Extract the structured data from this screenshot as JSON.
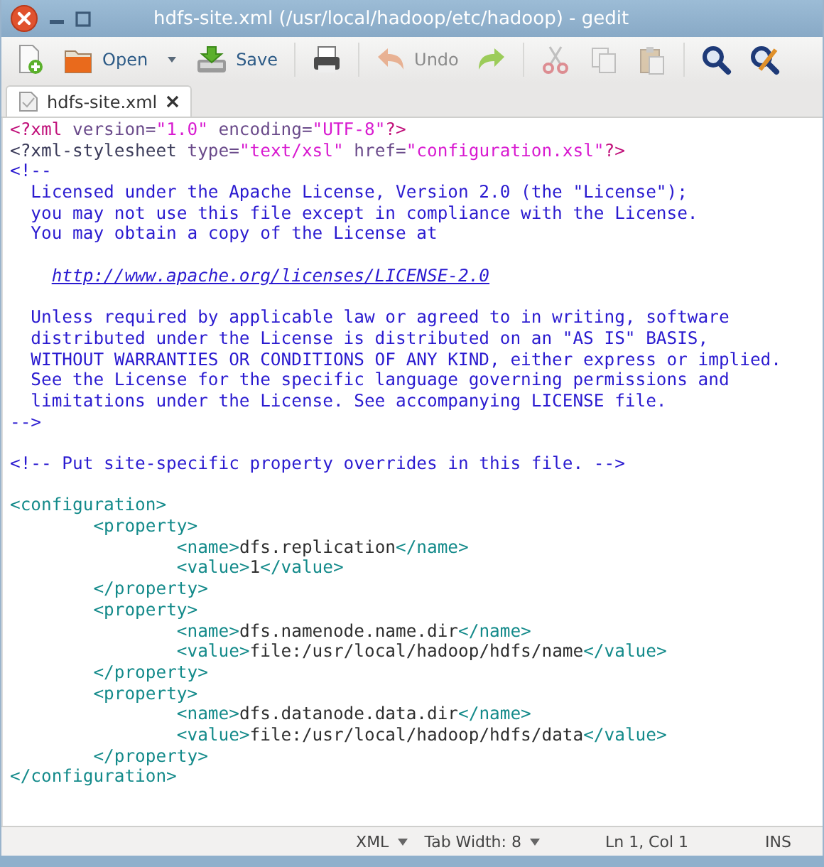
{
  "window": {
    "title": "hdfs-site.xml (/usr/local/hadoop/etc/hadoop) - gedit"
  },
  "toolbar": [
    {
      "kind": "button",
      "disabled": false
    },
    {
      "kind": "button",
      "label": "Open",
      "disabled": false
    },
    {
      "kind": "dropdown"
    },
    {
      "kind": "button",
      "label": "Save",
      "disabled": false
    },
    {
      "kind": "separator"
    },
    {
      "kind": "button",
      "disabled": false
    },
    {
      "kind": "separator"
    },
    {
      "kind": "button",
      "label": "Undo",
      "disabled": true
    },
    {
      "kind": "button",
      "disabled": false
    },
    {
      "kind": "separator"
    },
    {
      "kind": "button",
      "disabled": true
    },
    {
      "kind": "button",
      "disabled": true
    },
    {
      "kind": "button",
      "disabled": true
    },
    {
      "kind": "separator"
    },
    {
      "kind": "button",
      "disabled": false
    },
    {
      "kind": "button",
      "disabled": false
    }
  ],
  "tabs": [
    {
      "label": "hdfs-site.xml",
      "selected": true
    }
  ],
  "editor": {
    "lines": [
      {
        "kind": "code",
        "segments": [
          {
            "kind": "pi",
            "text": "<?xml"
          },
          {
            "kind": "attr",
            "text": " version="
          },
          {
            "kind": "string",
            "text": "\"1.0\""
          },
          {
            "kind": "attr",
            "text": " encoding="
          },
          {
            "kind": "string",
            "text": "\"UTF-8\""
          },
          {
            "kind": "pi",
            "text": "?>"
          }
        ]
      },
      {
        "kind": "code",
        "segments": [
          {
            "kind": "keyword",
            "text": "<?xml-stylesheet"
          },
          {
            "kind": "attr",
            "text": " type="
          },
          {
            "kind": "string",
            "text": "\"text/xsl\""
          },
          {
            "kind": "attr",
            "text": " href="
          },
          {
            "kind": "string",
            "text": "\"configuration.xsl\""
          },
          {
            "kind": "pi",
            "text": "?>"
          }
        ]
      },
      {
        "kind": "code",
        "segments": [
          {
            "kind": "comment",
            "text": "<!--"
          }
        ]
      },
      {
        "kind": "code",
        "segments": [
          {
            "kind": "comment",
            "text": "  Licensed under the Apache License, Version 2.0 (the \"License\");"
          }
        ]
      },
      {
        "kind": "code",
        "segments": [
          {
            "kind": "comment",
            "text": "  you may not use this file except in compliance with the License."
          }
        ]
      },
      {
        "kind": "code",
        "segments": [
          {
            "kind": "comment",
            "text": "  You may obtain a copy of the License at"
          }
        ]
      },
      {
        "kind": "blank"
      },
      {
        "kind": "code",
        "segments": [
          {
            "kind": "url",
            "text": "http://www.apache.org/licenses/LICENSE-2.0"
          }
        ]
      },
      {
        "kind": "blank"
      },
      {
        "kind": "code",
        "segments": [
          {
            "kind": "comment",
            "text": "  Unless required by applicable law or agreed to in writing, software"
          }
        ]
      },
      {
        "kind": "code",
        "segments": [
          {
            "kind": "comment",
            "text": "  distributed under the License is distributed on an \"AS IS\" BASIS,"
          }
        ]
      },
      {
        "kind": "code",
        "segments": [
          {
            "kind": "comment",
            "text": "  WITHOUT WARRANTIES OR CONDITIONS OF ANY KIND, either express or implied."
          }
        ]
      },
      {
        "kind": "code",
        "segments": [
          {
            "kind": "comment",
            "text": "  See the License for the specific language governing permissions and"
          }
        ]
      },
      {
        "kind": "code",
        "segments": [
          {
            "kind": "comment",
            "text": "  limitations under the License. See accompanying LICENSE file."
          }
        ]
      },
      {
        "kind": "code",
        "segments": [
          {
            "kind": "comment",
            "text": "-->"
          }
        ]
      },
      {
        "kind": "blank"
      },
      {
        "kind": "code",
        "segments": [
          {
            "kind": "comment",
            "text": "<!-- Put site-specific property overrides in this file. -->"
          }
        ]
      },
      {
        "kind": "blank"
      },
      {
        "kind": "code",
        "segments": [
          {
            "kind": "tag",
            "text": "<configuration>"
          }
        ]
      },
      {
        "kind": "code",
        "segments": [
          {
            "kind": "tag",
            "text": "\t<property>"
          }
        ]
      },
      {
        "kind": "code",
        "segments": [
          {
            "kind": "tag",
            "text": "\t\t<name>"
          },
          {
            "kind": "text",
            "text": "dfs.replication"
          },
          {
            "kind": "tag",
            "text": "</name>"
          }
        ]
      },
      {
        "kind": "code",
        "segments": [
          {
            "kind": "tag",
            "text": "\t\t<value>"
          },
          {
            "kind": "text",
            "text": "1"
          },
          {
            "kind": "tag",
            "text": "</value>"
          }
        ]
      },
      {
        "kind": "code",
        "segments": [
          {
            "kind": "tag",
            "text": "\t</property>"
          }
        ]
      },
      {
        "kind": "code",
        "segments": [
          {
            "kind": "tag",
            "text": "\t<property>"
          }
        ]
      },
      {
        "kind": "code",
        "segments": [
          {
            "kind": "tag",
            "text": "\t\t<name>"
          },
          {
            "kind": "text",
            "text": "dfs.namenode.name.dir"
          },
          {
            "kind": "tag",
            "text": "</name>"
          }
        ]
      },
      {
        "kind": "code",
        "segments": [
          {
            "kind": "tag",
            "text": "\t\t<value>"
          },
          {
            "kind": "text",
            "text": "file:/usr/local/hadoop/hdfs/name"
          },
          {
            "kind": "tag",
            "text": "</value>"
          }
        ]
      },
      {
        "kind": "code",
        "segments": [
          {
            "kind": "tag",
            "text": "\t</property>"
          }
        ]
      },
      {
        "kind": "code",
        "segments": [
          {
            "kind": "tag",
            "text": "\t<property>"
          }
        ]
      },
      {
        "kind": "code",
        "segments": [
          {
            "kind": "tag",
            "text": "\t\t<name>"
          },
          {
            "kind": "text",
            "text": "dfs.datanode.data.dir"
          },
          {
            "kind": "tag",
            "text": "</name>"
          }
        ]
      },
      {
        "kind": "code",
        "segments": [
          {
            "kind": "tag",
            "text": "\t\t<value>"
          },
          {
            "kind": "text",
            "text": "file:/usr/local/hadoop/hdfs/data"
          },
          {
            "kind": "tag",
            "text": "</value>"
          }
        ]
      },
      {
        "kind": "code",
        "segments": [
          {
            "kind": "tag",
            "text": "\t</property>"
          }
        ]
      },
      {
        "kind": "code",
        "segments": [
          {
            "kind": "tag",
            "text": "</configuration>"
          }
        ]
      }
    ]
  },
  "status_bar": [
    {
      "kind": "dropdown",
      "label": "XML"
    },
    {
      "kind": "dropdown",
      "label": "Tab Width: 8"
    },
    {
      "kind": "text",
      "label": "Ln 1, Col 1"
    },
    {
      "kind": "text",
      "label": "INS"
    }
  ]
}
